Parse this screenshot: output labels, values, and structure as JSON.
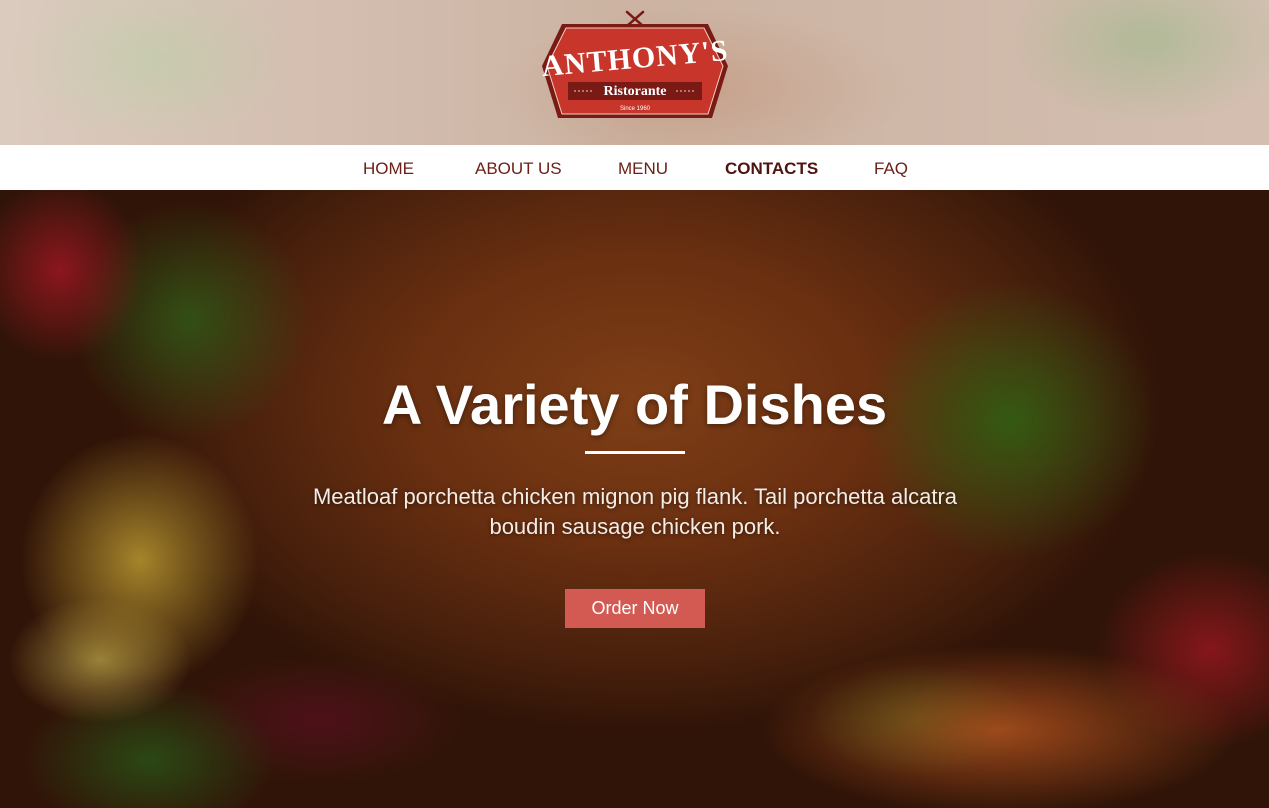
{
  "brand": {
    "name": "ANTHONY'S",
    "tagline": "Ristorante",
    "since": "Since 1960",
    "colors": {
      "badge": "#c8352b",
      "badge_border": "#7a1a14"
    }
  },
  "nav": {
    "items": [
      {
        "label": "HOME",
        "active": false
      },
      {
        "label": "ABOUT US",
        "active": false
      },
      {
        "label": "MENU",
        "active": false
      },
      {
        "label": "CONTACTS",
        "active": true
      },
      {
        "label": "FAQ",
        "active": false
      }
    ]
  },
  "hero": {
    "title": "A Variety of Dishes",
    "text": "Meatloaf porchetta chicken mignon pig flank. Tail porchetta alcatra boudin sausage chicken pork.",
    "cta_label": "Order Now",
    "cta_color": "#d35a52"
  }
}
